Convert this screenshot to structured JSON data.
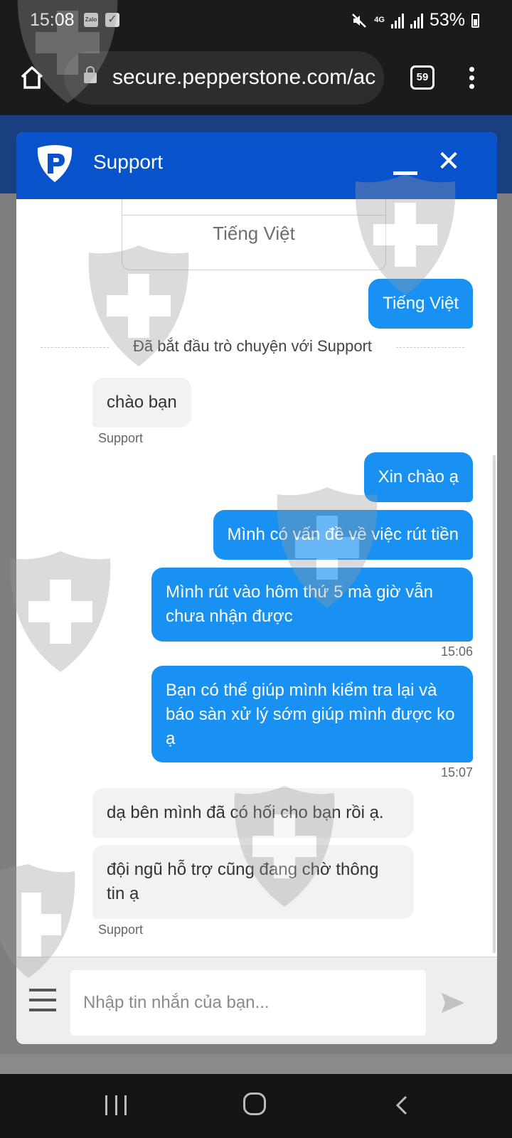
{
  "status_bar": {
    "time": "15:08",
    "notif_app": "Zalo",
    "network": "4G",
    "battery": "53%"
  },
  "browser": {
    "url": "secure.pepperstone.com/ac",
    "tab_count": "59"
  },
  "chat_widget": {
    "title": "Support",
    "language_option": "Tiếng Việt",
    "system_message": "Đã bắt đầu trò chuyện với Support",
    "messages": [
      {
        "from": "user",
        "text": "Tiếng Việt"
      },
      {
        "from": "agent",
        "text": "chào bạn",
        "sender": "Support"
      },
      {
        "from": "user",
        "text": "Xin chào ạ"
      },
      {
        "from": "user",
        "text": "Mình có vấn đề về việc rút tiền"
      },
      {
        "from": "user",
        "text": "Mình rút vào hôm thứ 5 mà giờ vẫn chưa nhận được",
        "time": "15:06"
      },
      {
        "from": "user",
        "text": "Bạn có thể giúp mình kiểm tra lại và báo sàn xử lý sớm giúp mình được ko ạ",
        "time": "15:07"
      },
      {
        "from": "agent",
        "text": "dạ bên mình đã có hối cho bạn rồi ạ."
      },
      {
        "from": "agent",
        "text": "đội ngũ hỗ trợ cũng đang chờ thông tin ạ",
        "sender": "Support"
      }
    ],
    "input_placeholder": "Nhập tin nhắn của bạn..."
  },
  "colors": {
    "header_blue": "#0853cb",
    "outgoing_bubble": "#1891f2",
    "incoming_bubble": "#f2f2f2"
  },
  "icons": [
    "home-icon",
    "lock-icon",
    "tabs-icon",
    "menu-icon",
    "pepperstone-logo-icon",
    "minimize-icon",
    "close-icon",
    "hamburger-menu-icon",
    "send-icon",
    "recent-apps-icon",
    "home-nav-icon",
    "back-icon"
  ]
}
